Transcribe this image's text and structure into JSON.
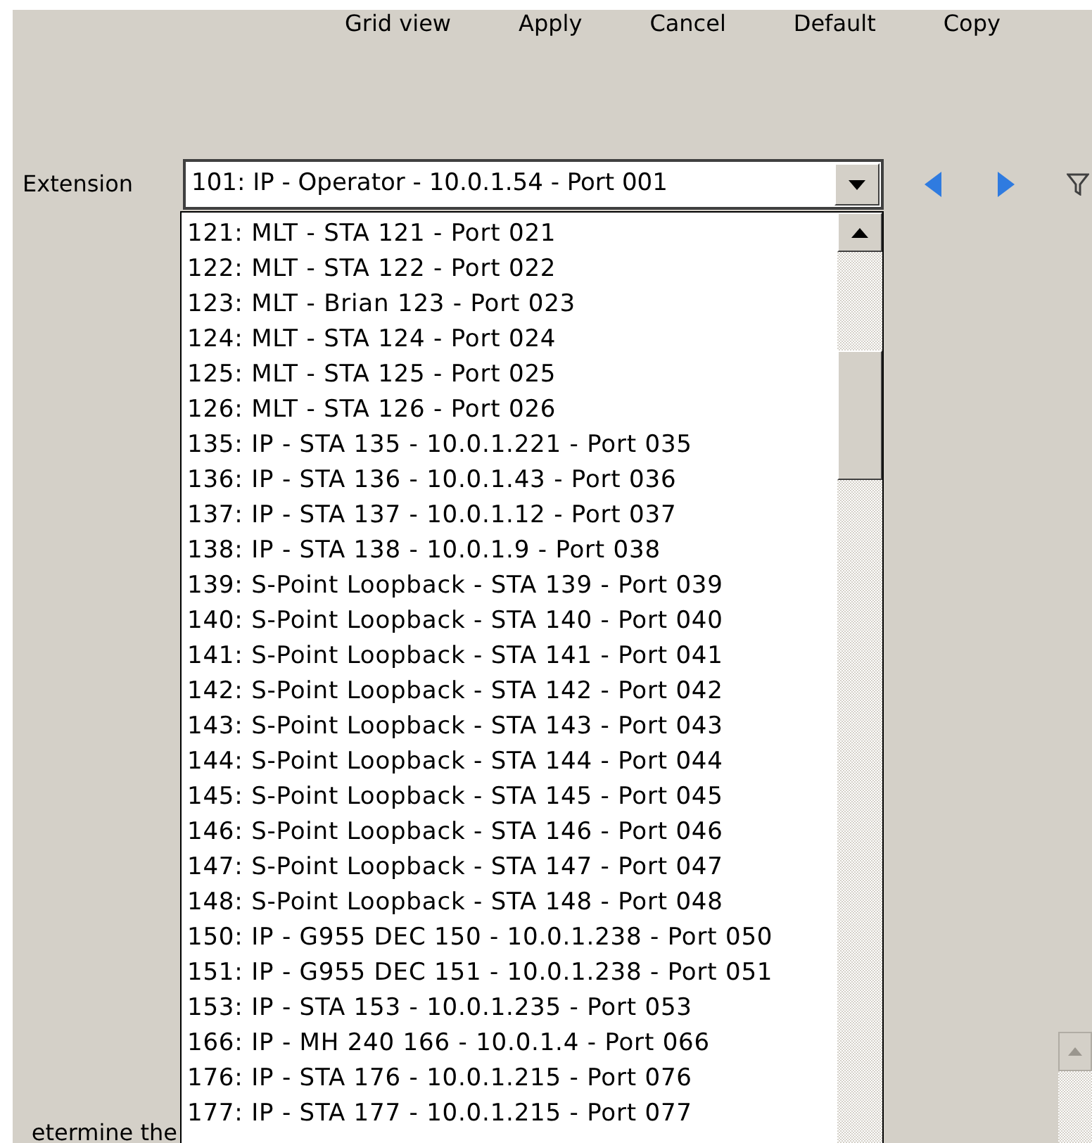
{
  "toolbar": {
    "buttons": [
      "Grid view",
      "Apply",
      "Cancel",
      "Default",
      "Copy"
    ]
  },
  "extension": {
    "label": "Extension",
    "value": "101: IP - Operator - 10.0.1.54 - Port 001",
    "expanded": true
  },
  "dropdown_items": [
    {
      "label": "121: MLT - STA 121 - Port 021"
    },
    {
      "label": "122: MLT - STA 122 - Port 022"
    },
    {
      "label": "123: MLT - Brian 123 - Port 023"
    },
    {
      "label": "124: MLT - STA 124 - Port 024"
    },
    {
      "label": "125: MLT - STA 125 - Port 025"
    },
    {
      "label": "126: MLT - STA 126 - Port 026"
    },
    {
      "label": "135: IP - STA 135 - 10.0.1.221 - Port 035"
    },
    {
      "label": "136: IP - STA 136 - 10.0.1.43 - Port 036"
    },
    {
      "label": "137: IP - STA 137 - 10.0.1.12 - Port 037"
    },
    {
      "label": "138: IP - STA 138 - 10.0.1.9 - Port 038"
    },
    {
      "label": "139: S-Point Loopback - STA 139 - Port 039"
    },
    {
      "label": "140: S-Point Loopback - STA 140 - Port 040"
    },
    {
      "label": "141: S-Point Loopback - STA 141 - Port 041"
    },
    {
      "label": "142: S-Point Loopback - STA 142 - Port 042"
    },
    {
      "label": "143: S-Point Loopback - STA 143 - Port 043"
    },
    {
      "label": "144: S-Point Loopback - STA 144 - Port 044"
    },
    {
      "label": "145: S-Point Loopback - STA 145 - Port 045"
    },
    {
      "label": "146: S-Point Loopback - STA 146 - Port 046"
    },
    {
      "label": "147: S-Point Loopback - STA 147 - Port 047"
    },
    {
      "label": "148: S-Point Loopback - STA 148 - Port 048"
    },
    {
      "label": "150: IP - G955 DEC 150 - 10.0.1.238 - Port 050"
    },
    {
      "label": "151: IP - G955 DEC 151 - 10.0.1.238 - Port 051"
    },
    {
      "label": "153: IP - STA 153 - 10.0.1.235 - Port 053"
    },
    {
      "label": "166: IP - MH 240 166 - 10.0.1.4 - Port 066"
    },
    {
      "label": "176: IP - STA 176 - 10.0.1.215 - Port 076"
    },
    {
      "label": "177: IP - STA 177 - 10.0.1.215 - Port 077"
    }
  ],
  "footer_text": "etermine the"
}
